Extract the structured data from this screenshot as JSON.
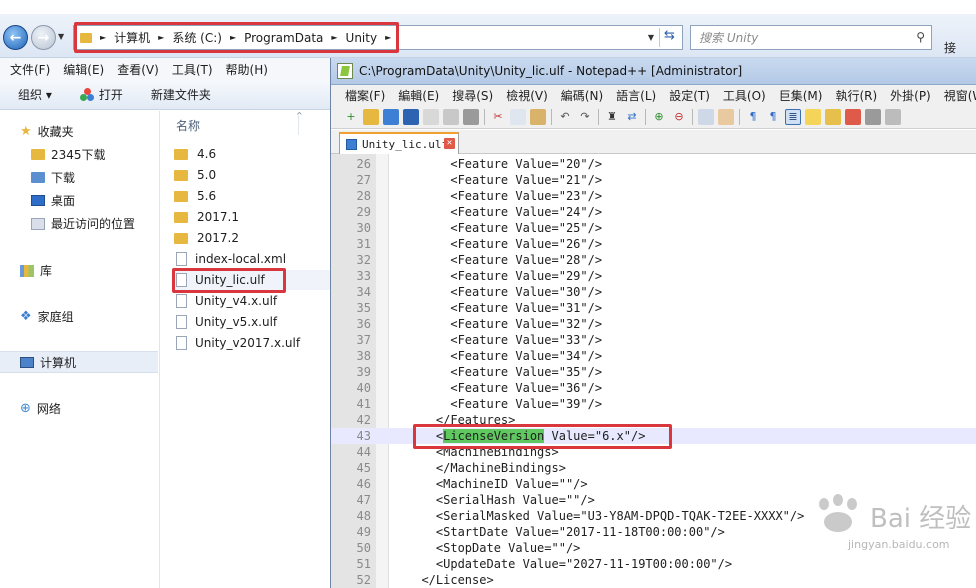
{
  "explorer": {
    "breadcrumb": [
      "计算机",
      "系统 (C:)",
      "ProgramData",
      "Unity"
    ],
    "search_placeholder": "搜索 Unity",
    "right_edge_text": "接",
    "menu": [
      "文件(F)",
      "编辑(E)",
      "查看(V)",
      "工具(T)",
      "帮助(H)"
    ],
    "toolbar": {
      "organize": "组织 ▾",
      "open": "打开",
      "new_folder": "新建文件夹"
    },
    "nav": {
      "favorites": "收藏夹",
      "fav_items": [
        "2345下载",
        "下载",
        "桌面",
        "最近访问的位置"
      ],
      "library": "库",
      "homegroup": "家庭组",
      "computer": "计算机",
      "network": "网络"
    },
    "column_name": "名称",
    "files": [
      {
        "name": "4.6",
        "type": "folder"
      },
      {
        "name": "5.0",
        "type": "folder"
      },
      {
        "name": "5.6",
        "type": "folder"
      },
      {
        "name": "2017.1",
        "type": "folder"
      },
      {
        "name": "2017.2",
        "type": "folder"
      },
      {
        "name": "index-local.xml",
        "type": "file"
      },
      {
        "name": "Unity_lic.ulf",
        "type": "file"
      },
      {
        "name": "Unity_v4.x.ulf",
        "type": "file"
      },
      {
        "name": "Unity_v5.x.ulf",
        "type": "file"
      },
      {
        "name": "Unity_v2017.x.ulf",
        "type": "file"
      }
    ]
  },
  "npp": {
    "title": "C:\\ProgramData\\Unity\\Unity_lic.ulf - Notepad++ [Administrator]",
    "menu": [
      "檔案(F)",
      "編輯(E)",
      "搜尋(S)",
      "檢視(V)",
      "編碼(N)",
      "語言(L)",
      "設定(T)",
      "工具(O)",
      "巨集(M)",
      "執行(R)",
      "外掛(P)",
      "視窗(W)"
    ],
    "tab_name": "Unity_lic.ulf",
    "lines": [
      {
        "n": "26",
        "t": "      <Feature Value=\"20\"/>"
      },
      {
        "n": "27",
        "t": "      <Feature Value=\"21\"/>"
      },
      {
        "n": "28",
        "t": "      <Feature Value=\"23\"/>"
      },
      {
        "n": "29",
        "t": "      <Feature Value=\"24\"/>"
      },
      {
        "n": "30",
        "t": "      <Feature Value=\"25\"/>"
      },
      {
        "n": "31",
        "t": "      <Feature Value=\"26\"/>"
      },
      {
        "n": "32",
        "t": "      <Feature Value=\"28\"/>"
      },
      {
        "n": "33",
        "t": "      <Feature Value=\"29\"/>"
      },
      {
        "n": "34",
        "t": "      <Feature Value=\"30\"/>"
      },
      {
        "n": "35",
        "t": "      <Feature Value=\"31\"/>"
      },
      {
        "n": "36",
        "t": "      <Feature Value=\"32\"/>"
      },
      {
        "n": "37",
        "t": "      <Feature Value=\"33\"/>"
      },
      {
        "n": "38",
        "t": "      <Feature Value=\"34\"/>"
      },
      {
        "n": "39",
        "t": "      <Feature Value=\"35\"/>"
      },
      {
        "n": "40",
        "t": "      <Feature Value=\"36\"/>"
      },
      {
        "n": "41",
        "t": "      <Feature Value=\"39\"/>"
      },
      {
        "n": "42",
        "t": "    </Features>"
      },
      {
        "n": "43",
        "t": ""
      },
      {
        "n": "44",
        "t": "    <MachineBindings>"
      },
      {
        "n": "45",
        "t": "    </MachineBindings>"
      },
      {
        "n": "46",
        "t": "    <MachineID Value=\"\"/>"
      },
      {
        "n": "47",
        "t": "    <SerialHash Value=\"\"/>"
      },
      {
        "n": "48",
        "t": "    <SerialMasked Value=\"U3-Y8AM-DPQD-TQAK-T2EE-XXXX\"/>"
      },
      {
        "n": "49",
        "t": "    <StartDate Value=\"2017-11-18T00:00:00\"/>"
      },
      {
        "n": "50",
        "t": "    <StopDate Value=\"\"/>"
      },
      {
        "n": "51",
        "t": "    <UpdateDate Value=\"2027-11-19T00:00:00\"/>"
      },
      {
        "n": "52",
        "t": "  </License>"
      }
    ],
    "line43": {
      "indent": "    <",
      "tag": "LicenseVersion",
      "rest": " Value=\"6.x\"/>"
    }
  },
  "watermark": {
    "logo": "Bai 经验",
    "url": "jingyan.baidu.com"
  }
}
